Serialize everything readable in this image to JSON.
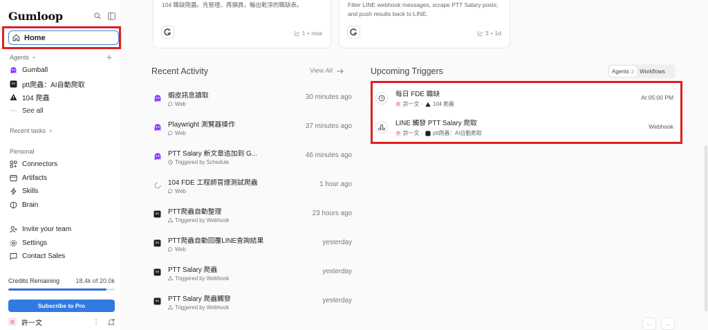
{
  "sidebar": {
    "logo": "Gumloop",
    "home_label": "Home",
    "agents_header": "Agents",
    "agents": [
      {
        "label": "Gumball",
        "icon": "ghost-icon",
        "color": "#8b3dff"
      },
      {
        "label": "ptt爬蟲：AI自動爬取",
        "icon": "terminal-icon",
        "color": "#1f1f1f"
      },
      {
        "label": "104 爬蟲",
        "icon": "warning-triangle-icon",
        "color": "#1f1f1f"
      }
    ],
    "see_all": "See all",
    "recent_tasks": "Recent tasks",
    "personal_header": "Personal",
    "personal_items": [
      {
        "label": "Connectors",
        "icon": "connectors-icon"
      },
      {
        "label": "Artifacts",
        "icon": "artifacts-icon"
      },
      {
        "label": "Skills",
        "icon": "lightning-icon"
      },
      {
        "label": "Brain",
        "icon": "brain-icon"
      }
    ],
    "bottom_items": [
      {
        "label": "Invite your team",
        "icon": "invite-icon"
      },
      {
        "label": "Settings",
        "icon": "gear-icon"
      },
      {
        "label": "Contact Sales",
        "icon": "chat-icon"
      }
    ],
    "credits_label": "Credits Remaining",
    "credits_value": "18.4k of 20.0k",
    "credits_fraction": 0.92,
    "subscribe_label": "Subscribe to Pro",
    "user_name": "許一文",
    "user_initial": "許"
  },
  "cards": [
    {
      "desc": "104 職缺爬蟲。先管理、再擷員，輸出乾淨的職缺表。",
      "count": "1",
      "time": "now"
    },
    {
      "desc": "Filter LINE webhook messages, scrape PTT Salary posts, and push results back to LINE.",
      "count": "3",
      "time": "1d"
    }
  ],
  "recent_activity": {
    "title": "Recent Activity",
    "view_all": "View All",
    "items": [
      {
        "title": "蝦皮訊息讀取",
        "sub": "Web",
        "sub_icon": "chat-bubble-icon",
        "time": "30 minutes ago",
        "icon": "ghost-icon"
      },
      {
        "title": "Playwright 測覽器操作",
        "sub": "Web",
        "sub_icon": "chat-bubble-icon",
        "time": "37 minutes ago",
        "icon": "ghost-icon"
      },
      {
        "title": "PTT Salary 新文章追加到 G...",
        "sub": "Triggered by Schedule",
        "sub_icon": "clock-icon",
        "time": "46 minutes ago",
        "icon": "ghost-icon"
      },
      {
        "title": "104 FDE 工程師冒煙測試爬蟲",
        "sub": "Web",
        "sub_icon": "chat-bubble-icon",
        "time": "1 hour ago",
        "icon": "spinner-icon"
      },
      {
        "title": "PTT爬蟲自動整理",
        "sub": "Triggered by Webhook",
        "sub_icon": "webhook-icon",
        "time": "23 hours ago",
        "icon": "terminal-icon"
      },
      {
        "title": "PTT爬蟲自動回覆LINE查詢結果",
        "sub": "Web",
        "sub_icon": "chat-bubble-icon",
        "time": "yesterday",
        "icon": "terminal-icon"
      },
      {
        "title": "PTT Salary 爬蟲",
        "sub": "Triggered by Webhook",
        "sub_icon": "webhook-icon",
        "time": "yesterday",
        "icon": "terminal-icon"
      },
      {
        "title": "PTT Salary 爬蟲觸發",
        "sub": "Triggered by Webhook",
        "sub_icon": "webhook-icon",
        "time": "yesterday",
        "icon": "terminal-icon"
      }
    ]
  },
  "upcoming_triggers": {
    "title": "Upcoming Triggers",
    "tabs": [
      {
        "label": "Agents",
        "count": "2",
        "active": true
      },
      {
        "label": "Workflows",
        "count": "",
        "active": false
      }
    ],
    "items": [
      {
        "title": "每日 FDE 職缺",
        "user": "許一文",
        "agent": "104 爬蟲",
        "agent_icon": "warning-triangle-icon",
        "right": "At 05:00 PM",
        "icon": "clock-icon"
      },
      {
        "title": "LINE 觸發 PTT Salary 爬取",
        "user": "許一文",
        "agent": "ptt爬蟲：AI自動爬取",
        "agent_icon": "terminal-icon",
        "right": "Webhook",
        "icon": "webhook-icon"
      }
    ]
  },
  "colors": {
    "accent": "#2f7be0",
    "highlight": "#e01e1e",
    "purple": "#8b3dff"
  }
}
